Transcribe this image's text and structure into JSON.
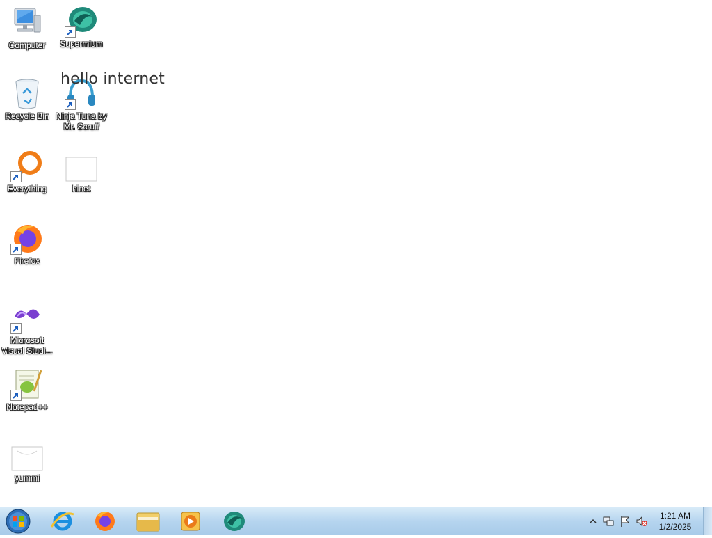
{
  "desktop": {
    "overlay_text": "hello internet",
    "icons": {
      "computer": "Computer",
      "supermium": "Supermium",
      "recycle_bin": "Recycle Bin",
      "ninja_tuna": "Ninja Tuna by Mr. Scruff",
      "everything": "Everything",
      "hinet": "hinet",
      "firefox": "Firefox",
      "visual_studio": "Microsoft Visual Studi...",
      "notepadpp": "Notepad++",
      "yummi": "yummi"
    }
  },
  "taskbar": {
    "pinned": [
      "start-orb",
      "internet-explorer-icon",
      "firefox-icon",
      "file-explorer-icon",
      "media-player-icon",
      "supermium-icon"
    ],
    "tray_icons": [
      "show-hidden-icons-chevron",
      "network-icon",
      "action-center-flag-icon",
      "volume-muted-icon"
    ],
    "clock": {
      "time": "1:21 AM",
      "date": "1/2/2025"
    }
  },
  "colors": {
    "taskbar_top": "#d8ebf8",
    "taskbar_bottom": "#a8cbe9",
    "desktop_bg": "#ffffff",
    "label_text": "#ffffff"
  }
}
